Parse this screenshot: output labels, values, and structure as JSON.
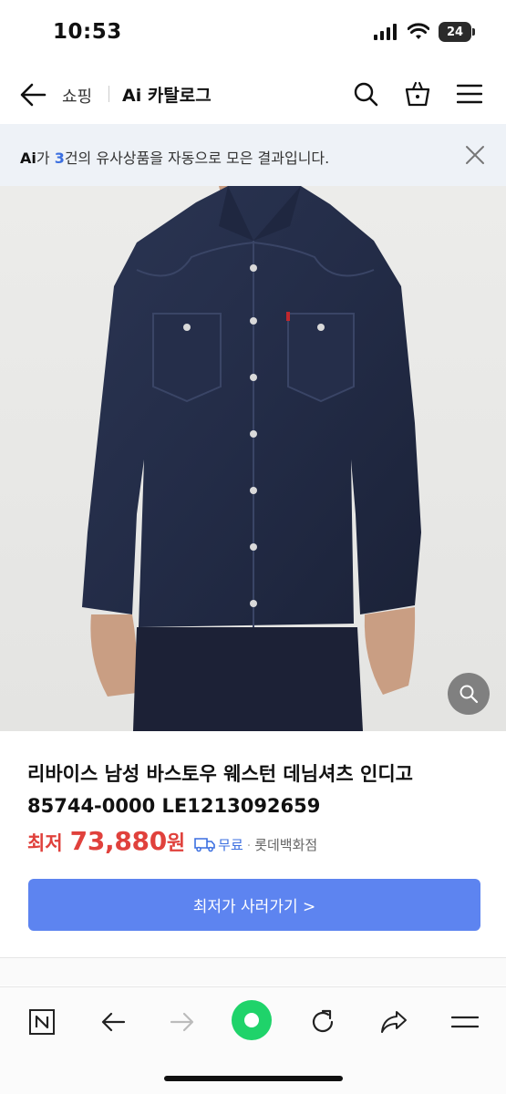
{
  "status_bar": {
    "time": "10:53",
    "battery": "24"
  },
  "header": {
    "crumb_shopping": "쇼핑",
    "crumb_catalog": "Ai 카탈로그"
  },
  "ai_banner": {
    "prefix": "Ai",
    "text_before": "가 ",
    "count": "3",
    "text_after": "건의 유사상품을 자동으로 모은 결과입니다."
  },
  "product": {
    "title": "리바이스 남성 바스토우 웨스턴 데님셔츠 인디고 85744-0000 LE1213092659",
    "price_label": "최저",
    "price_value": "73,880",
    "price_unit": "원",
    "shipping": "무료",
    "separator": "·",
    "seller": "롯데백화점",
    "buy_button": "최저가 사러가기 >"
  },
  "colors": {
    "price": "#e0413c",
    "accent": "#5d84f0",
    "home_button": "#1fd36a",
    "banner_bg": "#eef2f7"
  },
  "toolbar": {
    "icons": [
      "naver-n-icon",
      "back-arrow-icon",
      "forward-arrow-icon",
      "home-icon",
      "refresh-icon",
      "share-icon",
      "menu-icon"
    ]
  }
}
